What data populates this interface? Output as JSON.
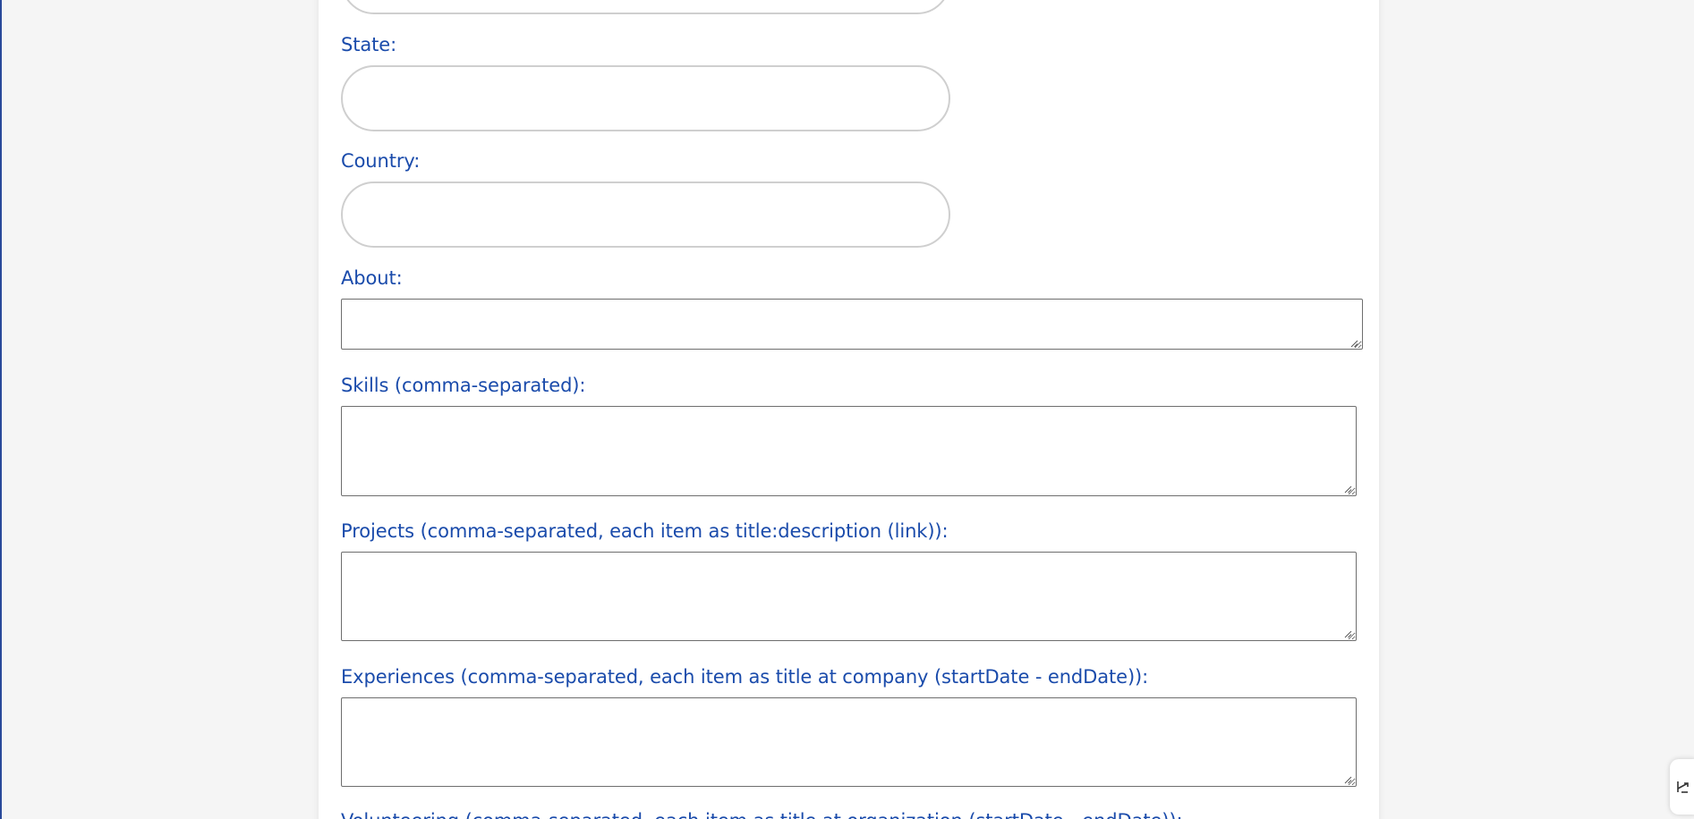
{
  "form": {
    "state": {
      "label": "State:",
      "value": "",
      "placeholder": ""
    },
    "country": {
      "label": "Country:",
      "value": "",
      "placeholder": ""
    },
    "about": {
      "label": "About:",
      "value": ""
    },
    "skills": {
      "label": "Skills (comma-separated):",
      "value": ""
    },
    "projects": {
      "label": "Projects (comma-separated, each item as title:description (link)):",
      "value": ""
    },
    "experiences": {
      "label": "Experiences (comma-separated, each item as title at company (startDate - endDate)):",
      "value": ""
    },
    "volunteering": {
      "label": "Volunteering (comma-separated, each item as title at organization (startDate - endDate)):"
    }
  },
  "colors": {
    "label_text": "#1a4bab",
    "page_background": "#f5f5f5",
    "card_background": "#ffffff",
    "pill_border": "#cfcfcf",
    "textarea_border": "#6e6e6e",
    "left_edge_accent": "#2a4a9a"
  },
  "icons": {
    "side_widget": "expand-icon",
    "resize_grip": "resize-grip-icon"
  }
}
